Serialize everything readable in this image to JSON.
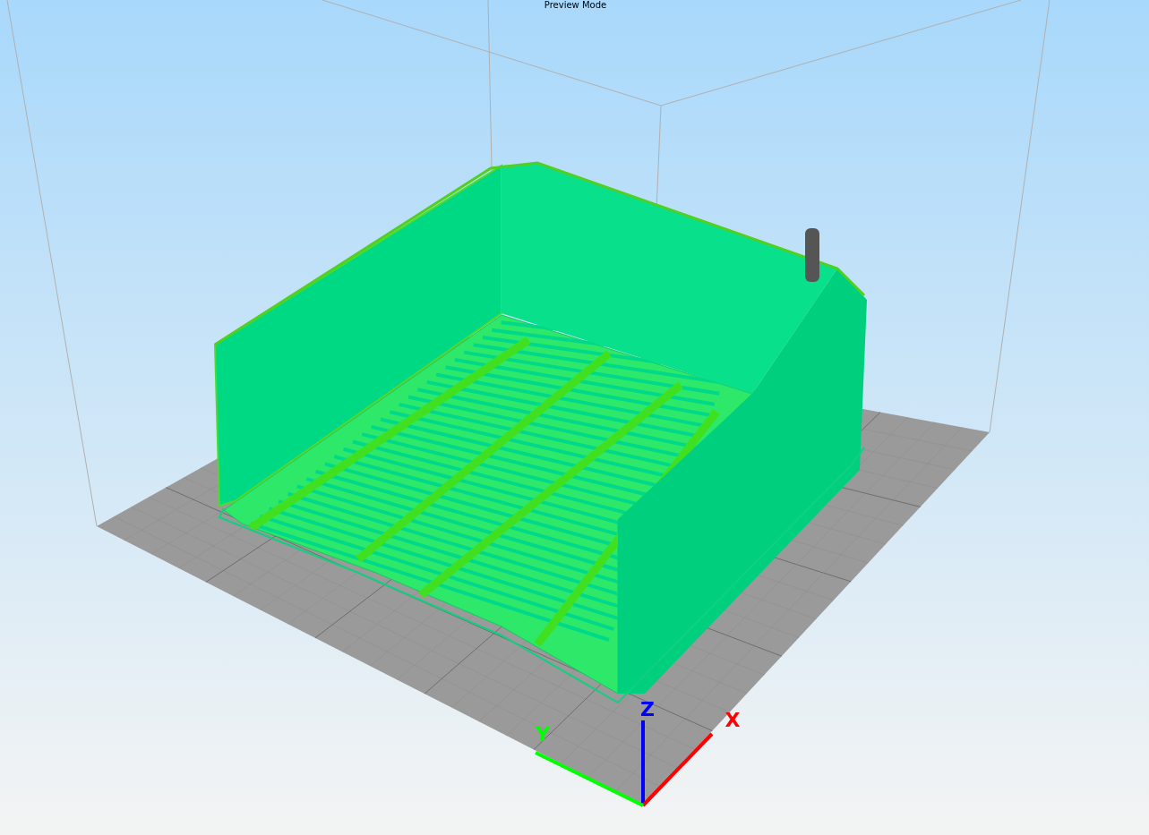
{
  "viewport": {
    "mode_label": "Preview Mode"
  },
  "axes": [
    {
      "label": "Z",
      "color": "#0000ff"
    },
    {
      "label": "X",
      "color": "#ff0000"
    },
    {
      "label": "Y",
      "color": "#00ff00"
    }
  ]
}
